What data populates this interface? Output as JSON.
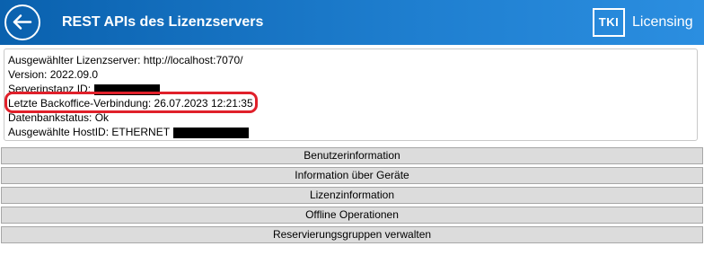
{
  "header": {
    "title": "REST APIs des Lizenzservers",
    "back_icon": "back-arrow-icon",
    "logo_mark": "TKI",
    "logo_text": "Licensing",
    "colors": {
      "header_start": "#0a61ae",
      "header_end": "#2b8ee0",
      "highlight": "#e0202a"
    }
  },
  "info": {
    "server": "Ausgewählter Lizenzserver: http://localhost:7070/",
    "version": "Version: 2022.09.0",
    "instance_label": "Serverinstanz ID:",
    "backoffice": "Letzte Backoffice-Verbindung: 26.07.2023 12:21:35",
    "db_status": "Datenbankstatus: Ok",
    "hostid_label": "Ausgewählte HostID: ETHERNET"
  },
  "buttons": {
    "user_info": "Benutzerinformation",
    "device_info": "Information über Geräte",
    "license_info": "Lizenzinformation",
    "offline_ops": "Offline Operationen",
    "reservation_groups": "Reservierungsgruppen verwalten"
  }
}
